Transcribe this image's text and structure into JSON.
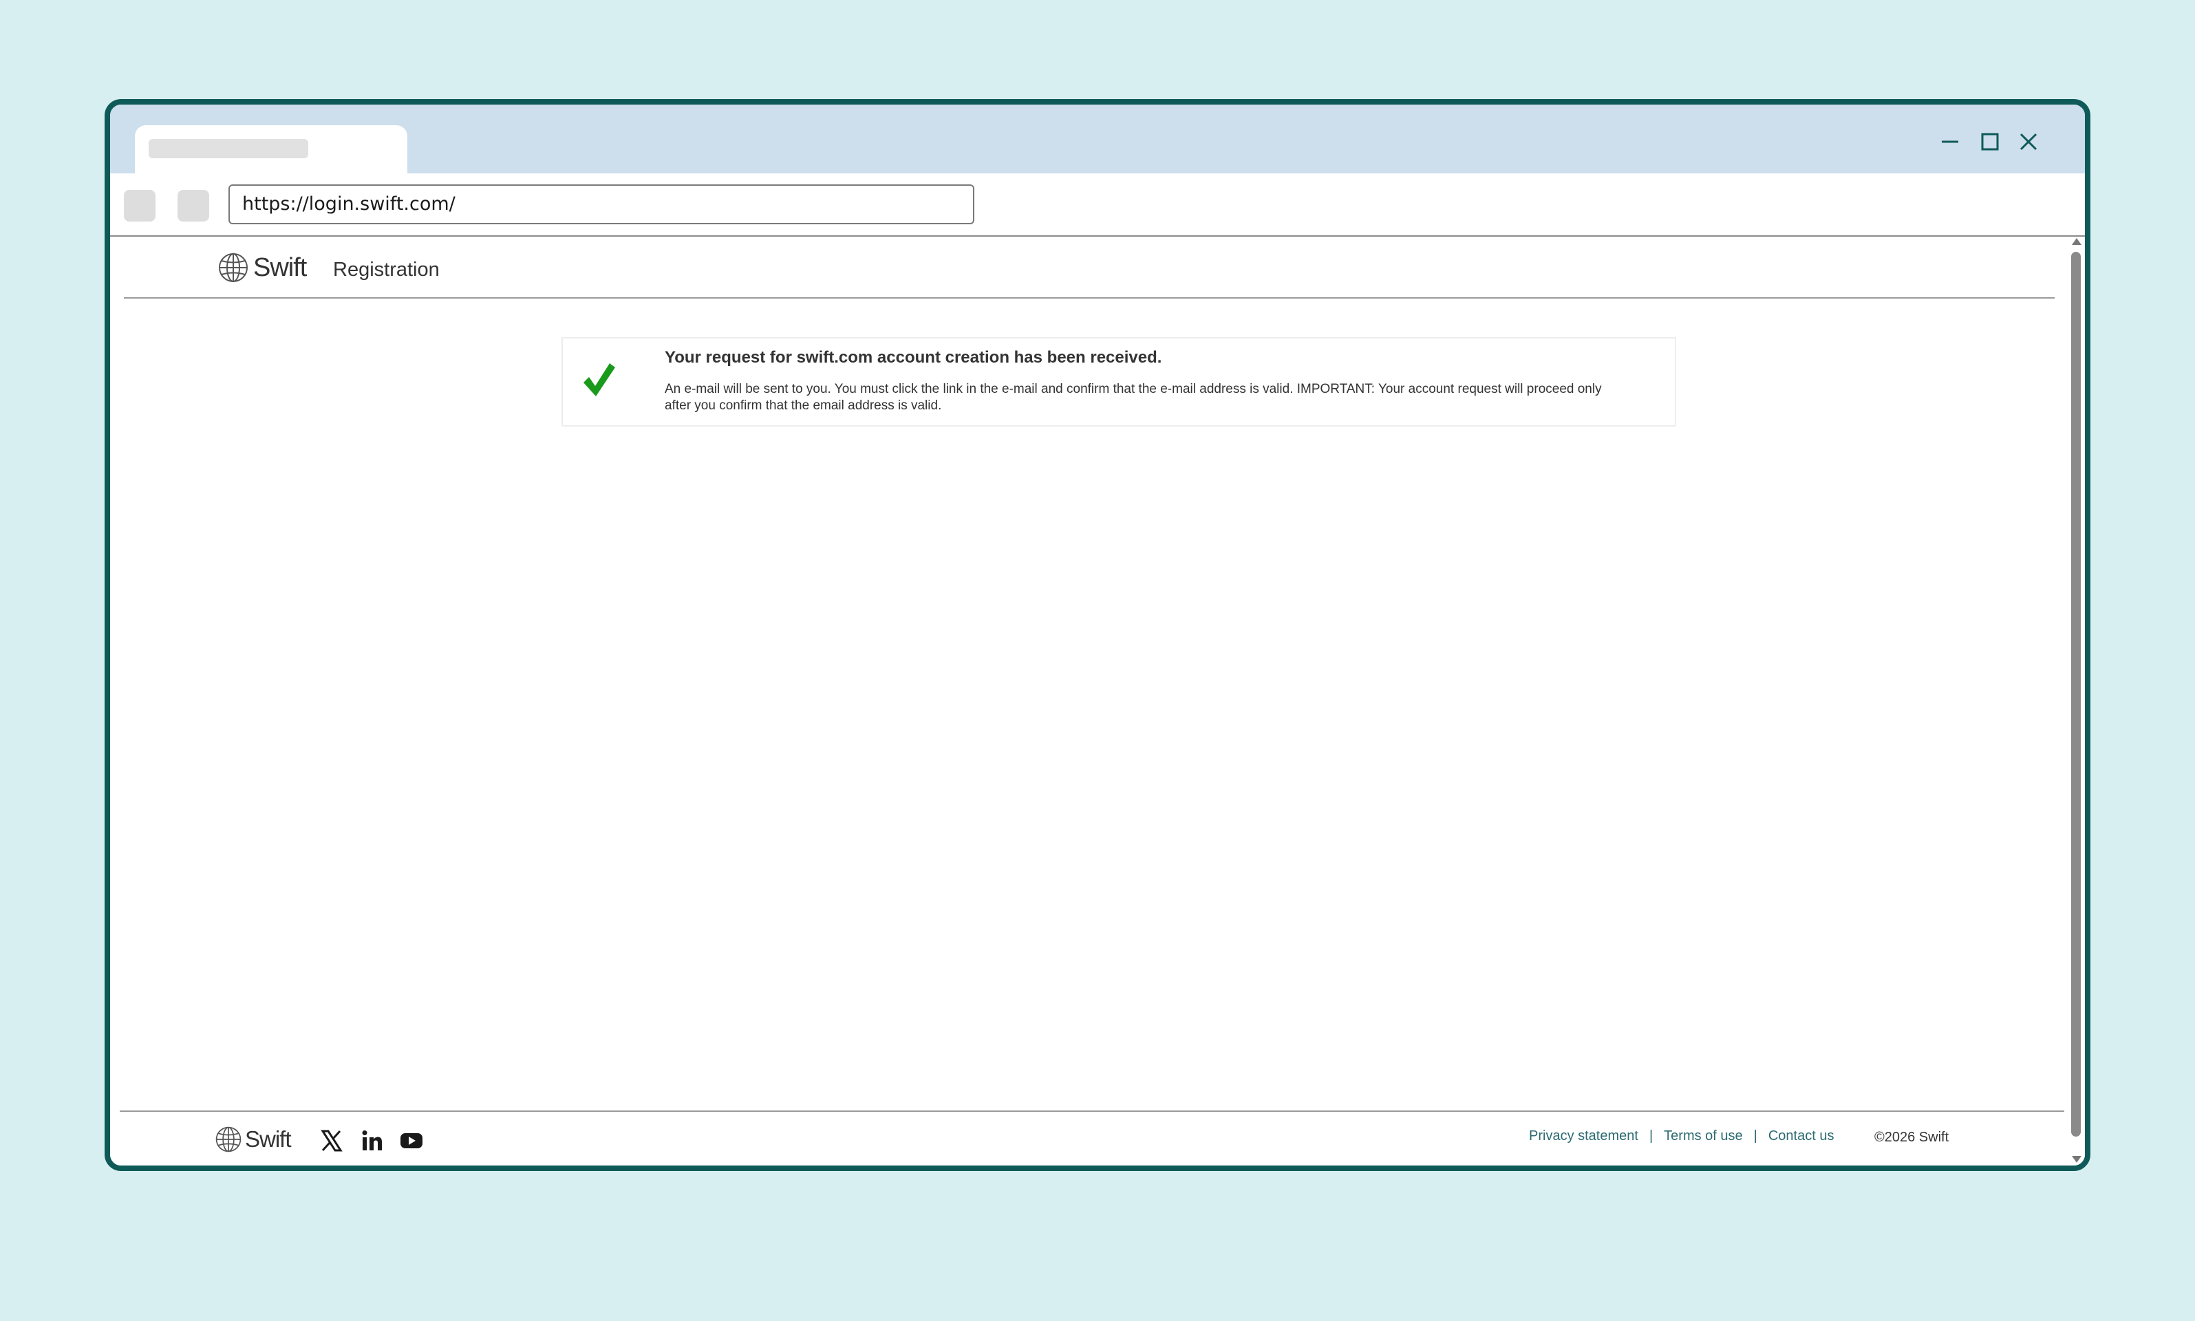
{
  "browser": {
    "url": "https://login.swift.com/"
  },
  "header": {
    "logo_text": "Swift",
    "title": "Registration"
  },
  "notice": {
    "title": "Your request for swift.com account creation has been received.",
    "body": "An e-mail will be sent to you. You must click the link in the e-mail and confirm that the e-mail address is valid. IMPORTANT: Your account request will proceed only after you confirm that the email address is valid.",
    "icon": "checkmark-icon",
    "icon_color": "#1a9a1a"
  },
  "footer": {
    "logo_text": "Swift",
    "social": [
      "x-icon",
      "linkedin-icon",
      "youtube-icon"
    ],
    "links": [
      "Privacy statement",
      "Terms of use",
      "Contact us"
    ],
    "separator": "|",
    "copyright": "©2026 Swift"
  },
  "colors": {
    "frame": "#0e5a58",
    "page_background": "#d7eff0",
    "tab_bar": "#cddeec",
    "link": "#2b6a70"
  }
}
